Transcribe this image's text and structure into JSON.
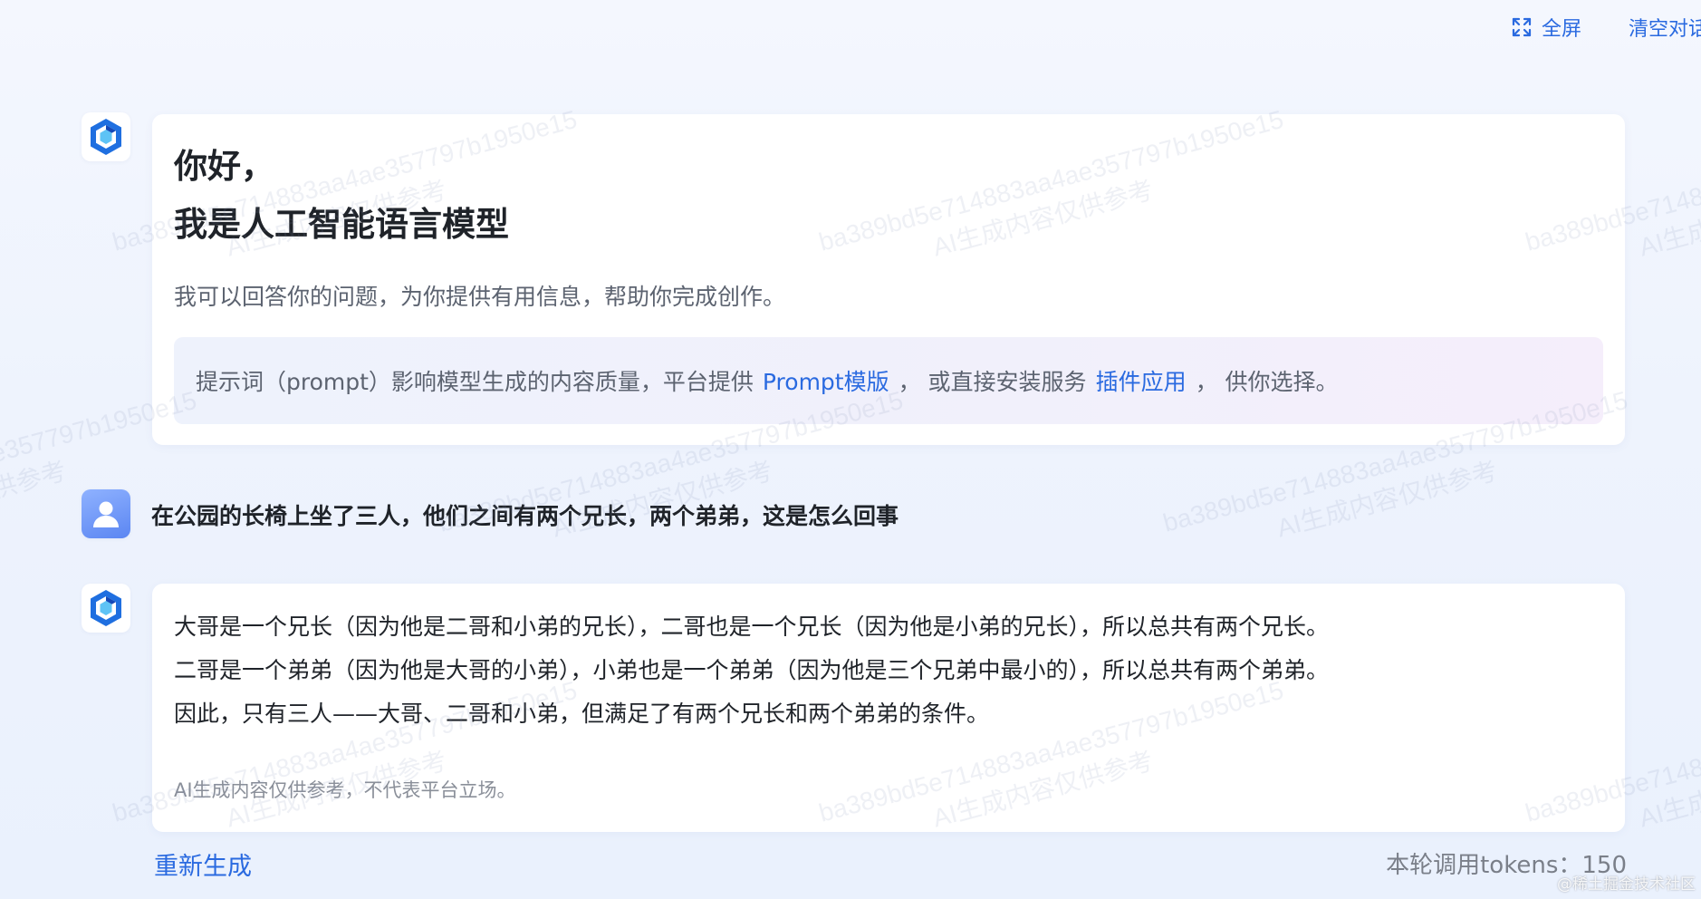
{
  "toolbar": {
    "fullscreen_label": "全屏",
    "clear_label": "清空对话"
  },
  "welcome": {
    "greeting_line1": "你好，",
    "greeting_line2": "我是人工智能语言模型",
    "description": "我可以回答你的问题，为你提供有用信息，帮助你完成创作。",
    "tip_prefix": "提示词（prompt）影响模型生成的内容质量，平台提供",
    "tip_link_templates": "Prompt模版",
    "tip_middle": "， 或直接安装服务",
    "tip_link_plugins": "插件应用",
    "tip_suffix": "， 供你选择。"
  },
  "conversation": {
    "user_message": "在公园的长椅上坐了三人，他们之间有两个兄长，两个弟弟，这是怎么回事",
    "answer_lines": [
      "大哥是一个兄长（因为他是二哥和小弟的兄长），二哥也是一个兄长（因为他是小弟的兄长），所以总共有两个兄长。",
      "二哥是一个弟弟（因为他是大哥的小弟），小弟也是一个弟弟（因为他是三个兄弟中最小的），所以总共有两个弟弟。",
      "因此，只有三人——大哥、二哥和小弟，但满足了有两个兄长和两个弟弟的条件。"
    ],
    "disclaimer": "AI生成内容仅供参考，不代表平台立场。"
  },
  "footer": {
    "regenerate_label": "重新生成",
    "tokens_text": "本轮调用tokens：150"
  },
  "watermark": {
    "hash": "ba389bd5e714883aa4ae357797b1950e15",
    "note": "AI生成内容仅供参考"
  },
  "site_mark": "@稀土掘金技术社区",
  "colors": {
    "accent": "#2a6ae0",
    "background": "#eef3fd",
    "card": "#ffffff",
    "text_primary": "#1f2329",
    "text_secondary": "#5c6370"
  },
  "icons": {
    "assistant_avatar": "hexagon-logo-icon",
    "user_avatar": "user-icon",
    "fullscreen": "expand-icon"
  }
}
